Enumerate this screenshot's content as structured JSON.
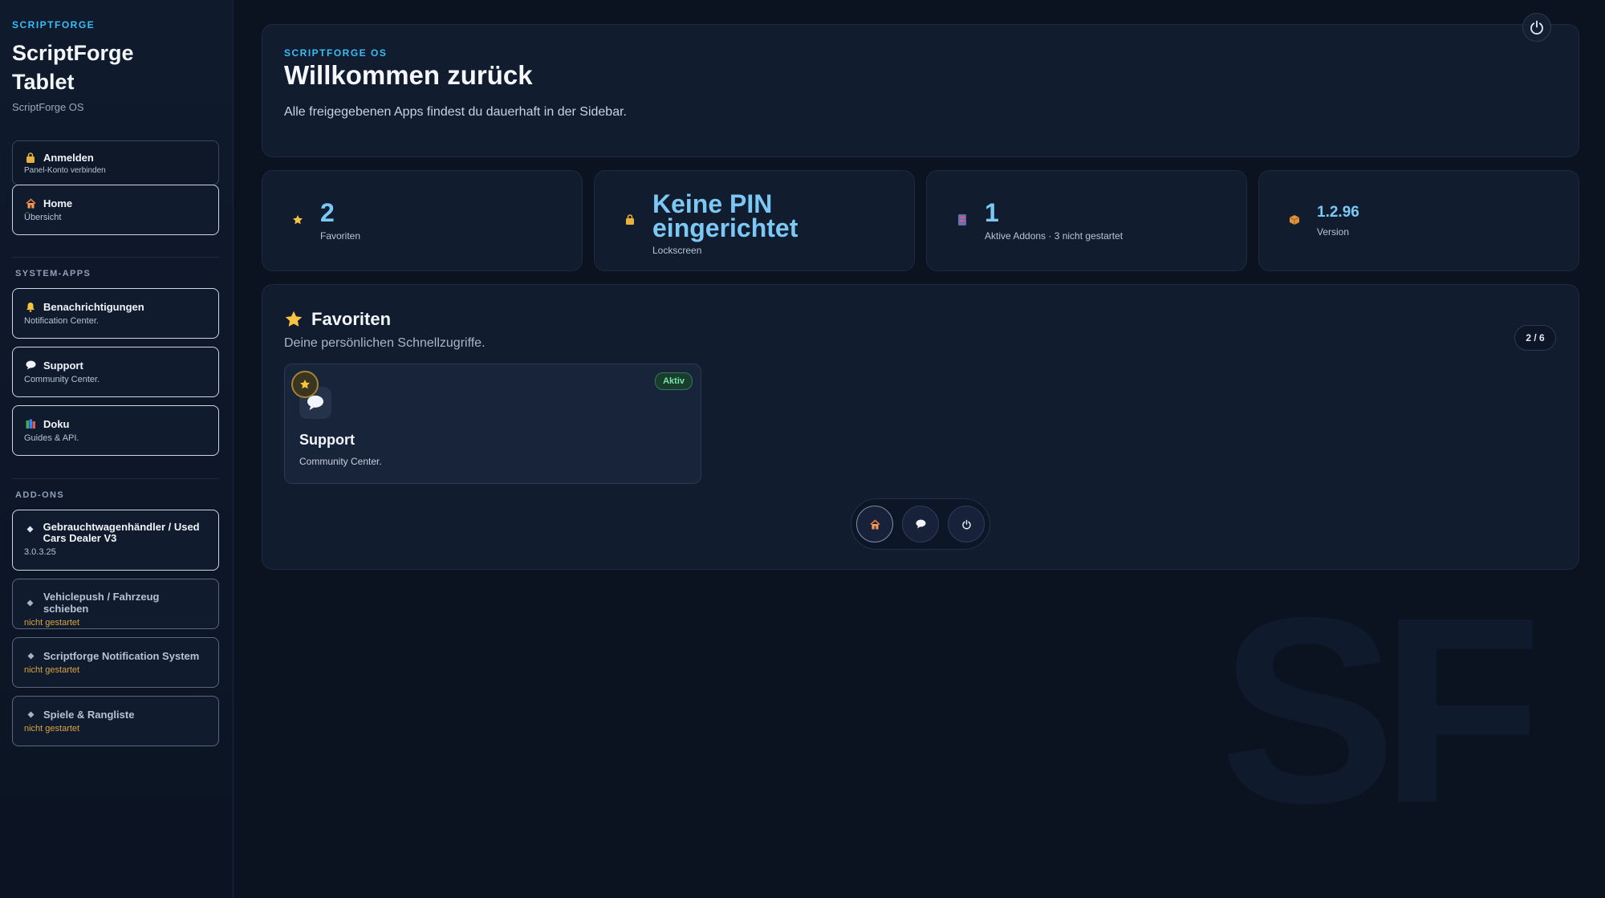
{
  "sidebar": {
    "kicker": "SCRIPTFORGE",
    "title": "ScriptForge Tablet",
    "subtitle": "ScriptForge OS",
    "login": {
      "title": "Anmelden",
      "sub": "Panel-Konto verbinden"
    },
    "home": {
      "title": "Home",
      "sub": "Übersicht"
    },
    "system_label": "SYSTEM-APPS",
    "system_apps": [
      {
        "title": "Benachrichtigungen",
        "sub": "Notification Center."
      },
      {
        "title": "Support",
        "sub": "Community Center."
      },
      {
        "title": "Doku",
        "sub": "Guides & API."
      }
    ],
    "addons_label": "ADD-ONS",
    "addons": [
      {
        "title": "Gebrauchtwagenhändler / Used Cars Dealer V3",
        "sub": "3.0.3.25"
      },
      {
        "title": "Vehiclepush / Fahrzeug schieben",
        "sub": "nicht gestartet"
      },
      {
        "title": "Scriptforge Notification System",
        "sub": "nicht gestartet"
      },
      {
        "title": "Spiele & Rangliste",
        "sub": "nicht gestartet"
      }
    ]
  },
  "hero": {
    "kicker": "SCRIPTFORGE OS",
    "title": "Willkommen zurück",
    "description": "Alle freigegebenen Apps findest du dauerhaft in der Sidebar."
  },
  "stats": [
    {
      "icon": "star-icon",
      "value": "2",
      "label": "Favoriten"
    },
    {
      "icon": "lock-icon",
      "value": "Keine PIN eingerichtet",
      "label": "Lockscreen"
    },
    {
      "icon": "puzzle-icon",
      "value": "1",
      "label": "Aktive Addons · 3 nicht gestartet"
    },
    {
      "icon": "box-icon",
      "value": "1.2.96",
      "label": "Version"
    }
  ],
  "favorites": {
    "title": "Favoriten",
    "subtitle": "Deine persönlichen Schnellzugriffe.",
    "pager": "2 / 6",
    "card": {
      "name": "Support",
      "sub": "Community Center.",
      "status": "Aktiv"
    }
  },
  "watermark": "SF",
  "colors": {
    "accent": "#38bdf8",
    "value": "#7cc8f5",
    "warn": "#d9a441",
    "active": "#7ee2a8",
    "star": "#f5c542"
  }
}
